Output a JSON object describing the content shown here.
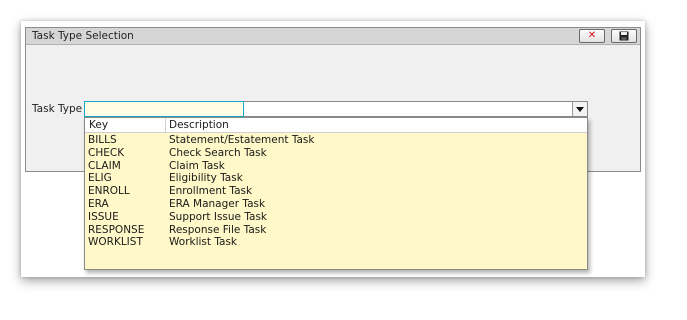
{
  "dialog": {
    "title": "Task Type Selection",
    "close_icon": "close-icon",
    "save_icon": "save-icon"
  },
  "form": {
    "task_type_label": "Task Type",
    "task_type_value": ""
  },
  "dropdown": {
    "columns": [
      "Key",
      "Description"
    ],
    "rows": [
      {
        "key": "BILLS",
        "description": "Statement/Estatement Task"
      },
      {
        "key": "CHECK",
        "description": "Check Search Task"
      },
      {
        "key": "CLAIM",
        "description": "Claim Task"
      },
      {
        "key": "ELIG",
        "description": "Eligibility Task"
      },
      {
        "key": "ENROLL",
        "description": "Enrollment Task"
      },
      {
        "key": "ERA",
        "description": "ERA Manager Task"
      },
      {
        "key": "ISSUE",
        "description": "Support Issue Task"
      },
      {
        "key": "RESPONSE",
        "description": "Response File Task"
      },
      {
        "key": "WORKLIST",
        "description": "Worklist Task"
      }
    ],
    "background_color": "#fff8c8"
  }
}
